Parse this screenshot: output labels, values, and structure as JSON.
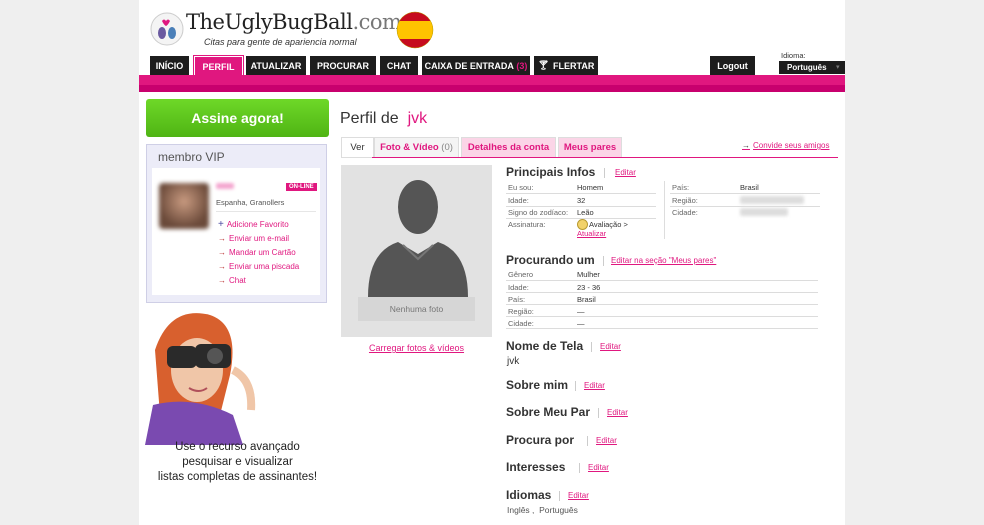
{
  "header": {
    "logo_main": "TheUglyBugBall",
    "logo_com": ".com",
    "tagline": "Citas para gente de apariencia normal",
    "language_label": "Idioma:",
    "language_value": "Português",
    "logout": "Logout"
  },
  "nav": [
    {
      "label": "INÍCIO"
    },
    {
      "label": "PERFIL"
    },
    {
      "label": "ATUALIZAR"
    },
    {
      "label": "PROCURAR"
    },
    {
      "label": "CHAT"
    },
    {
      "label": "CAIXA DE ENTRADA",
      "count": "(3)"
    },
    {
      "label": "FLERTAR"
    }
  ],
  "sidebar": {
    "subscribe_button": "Assine agora!",
    "vip_title": "membro VIP",
    "online_badge": "ON-LINE",
    "member_location": "Espanha, Granollers",
    "links": [
      "Adicione Favorito",
      "Enviar um e-mail",
      "Mandar um Cartão",
      "Enviar uma piscada",
      "Chat"
    ],
    "promo_text": [
      "Use o recurso avançado",
      "pesquisar e visualizar",
      "listas completas de assinantes!"
    ]
  },
  "profile": {
    "title_prefix": "Perfil de",
    "username": "jvk",
    "tabs": [
      {
        "label": "Ver"
      },
      {
        "label": "Foto & Vídeo",
        "count": "(0)"
      },
      {
        "label": "Detalhes da conta"
      },
      {
        "label": "Meus pares"
      }
    ],
    "invite_link": "Convide seus amigos",
    "no_photo": "Nenhuma foto",
    "upload_link": "Carregar fotos & vídeos",
    "edit_label": "Editar",
    "main_info": {
      "title": "Principais Infos",
      "left": [
        {
          "label": "Eu sou:",
          "value": "Homem"
        },
        {
          "label": "Idade:",
          "value": "32"
        },
        {
          "label": "Signo do zodíaco:",
          "value": "Leão"
        },
        {
          "label": "Assinatura:",
          "value": "Avaliação  >"
        }
      ],
      "signature_link": "Atualizar",
      "right": [
        {
          "label": "País:",
          "value": "Brasil"
        },
        {
          "label": "Região:",
          "value": ""
        },
        {
          "label": "Cidade:",
          "value": ""
        }
      ]
    },
    "looking_for": {
      "title": "Procurando um",
      "edit_label": "Editar na seção \"Meus pares\"",
      "rows": [
        {
          "label": "Gênero",
          "value": "Mulher"
        },
        {
          "label": "Idade:",
          "value": "23 - 36"
        },
        {
          "label": "País:",
          "value": "Brasil"
        },
        {
          "label": "Região:",
          "value": "—"
        },
        {
          "label": "Cidade:",
          "value": "—"
        }
      ]
    },
    "screen_name": {
      "title": "Nome de Tela",
      "value": "jvk"
    },
    "about_me": {
      "title": "Sobre mim"
    },
    "about_match": {
      "title": "Sobre Meu Par"
    },
    "seeking": {
      "title": "Procura por"
    },
    "interests": {
      "title": "Interesses"
    },
    "languages": {
      "title": "Idiomas",
      "value": "Inglês ,  Português"
    }
  },
  "colors": {
    "brand": "#e0177f",
    "green": "#5cc51a",
    "nav": "#1d1d1d"
  }
}
